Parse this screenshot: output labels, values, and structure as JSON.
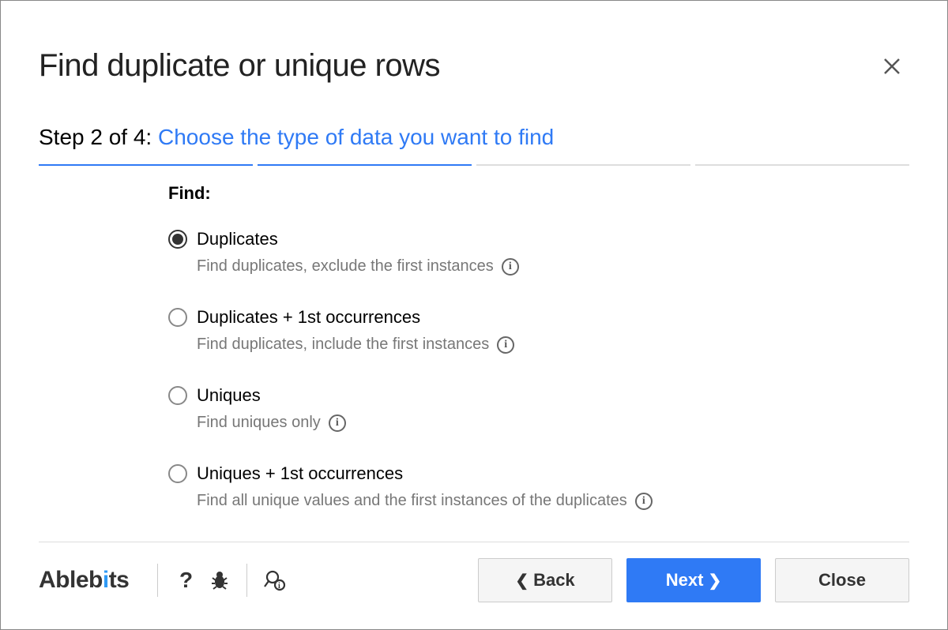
{
  "dialog": {
    "title": "Find duplicate or unique rows",
    "step_prefix": "Step 2 of 4: ",
    "step_desc": "Choose the type of data you want to find"
  },
  "find_label": "Find:",
  "options": [
    {
      "label": "Duplicates",
      "desc": "Find duplicates, exclude the first instances",
      "selected": true
    },
    {
      "label": "Duplicates + 1st occurrences",
      "desc": "Find duplicates, include the first instances",
      "selected": false
    },
    {
      "label": "Uniques",
      "desc": "Find uniques only",
      "selected": false
    },
    {
      "label": "Uniques + 1st occurrences",
      "desc": "Find all unique values and the first instances of the duplicates",
      "selected": false
    }
  ],
  "footer": {
    "brand": "Ablebits",
    "back": "Back",
    "next": "Next",
    "close": "Close"
  },
  "progress": {
    "current": 2,
    "total": 4
  },
  "info_glyph": "i"
}
